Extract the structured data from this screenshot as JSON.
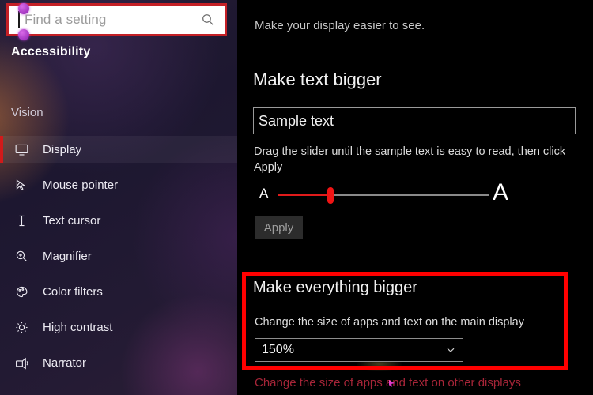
{
  "sidebar": {
    "search": {
      "placeholder": "Find a setting",
      "icon": "search-icon"
    },
    "app_title": "Accessibility",
    "group_title": "Vision",
    "items": [
      {
        "label": "Display",
        "icon": "monitor-icon",
        "selected": true
      },
      {
        "label": "Mouse pointer",
        "icon": "mouse-pointer-icon",
        "selected": false
      },
      {
        "label": "Text cursor",
        "icon": "text-cursor-icon",
        "selected": false
      },
      {
        "label": "Magnifier",
        "icon": "magnifier-icon",
        "selected": false
      },
      {
        "label": "Color filters",
        "icon": "palette-icon",
        "selected": false
      },
      {
        "label": "High contrast",
        "icon": "brightness-icon",
        "selected": false
      },
      {
        "label": "Narrator",
        "icon": "narrator-icon",
        "selected": false
      }
    ]
  },
  "main": {
    "subhead": "Make your display easier to see.",
    "text_section": {
      "heading": "Make text bigger",
      "sample_value": "Sample text",
      "hint": "Drag the slider until the sample text is easy to read, then click Apply",
      "slider": {
        "min_label": "A",
        "max_label": "A",
        "value_percent": 24
      },
      "apply_label": "Apply"
    },
    "scale_section": {
      "heading": "Make everything bigger",
      "description": "Change the size of apps and text on the main display",
      "dropdown_value": "150%",
      "dropdown_icon": "chevron-down-icon",
      "link_label": "Change the size of apps and text on other displays"
    }
  },
  "colors": {
    "accent_red": "#ff0000",
    "search_outline": "#c42026",
    "selection_bar": "#d11a1a",
    "slider_fill": "#e01b1b",
    "link_red": "#a62538",
    "handle_purple": "#8b1fb0"
  }
}
